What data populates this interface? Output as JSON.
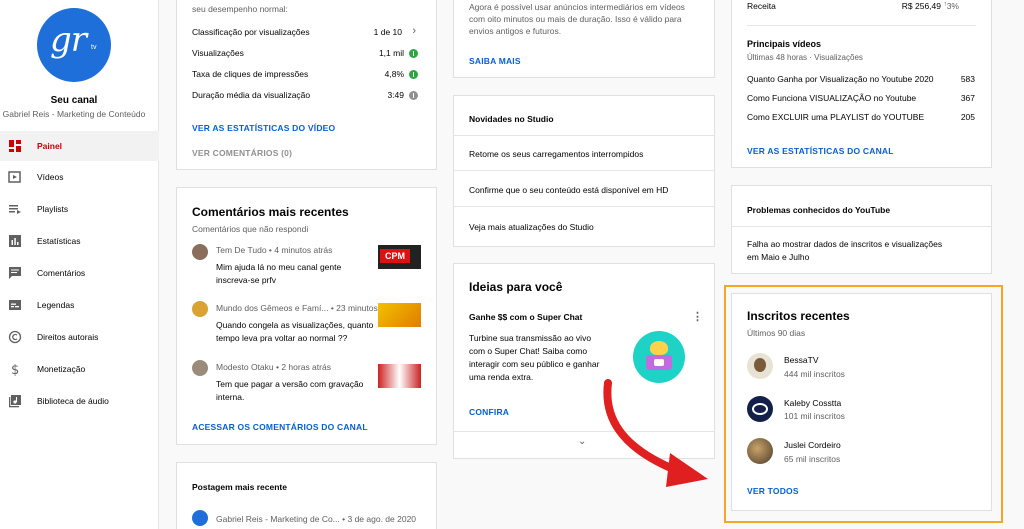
{
  "sidebar": {
    "logo_text": "gr",
    "logo_sub": "tv",
    "channel_title": "Seu canal",
    "channel_name": "Gabriel Reis - Marketing de Conteúdo",
    "items": [
      {
        "label": "Painel",
        "icon": "dashboard-icon",
        "active": true
      },
      {
        "label": "Vídeos",
        "icon": "video-icon"
      },
      {
        "label": "Playlists",
        "icon": "playlist-icon"
      },
      {
        "label": "Estatísticas",
        "icon": "analytics-icon"
      },
      {
        "label": "Comentários",
        "icon": "comments-icon"
      },
      {
        "label": "Legendas",
        "icon": "subtitles-icon"
      },
      {
        "label": "Direitos autorais",
        "icon": "copyright-icon"
      },
      {
        "label": "Monetização",
        "icon": "dollar-icon"
      },
      {
        "label": "Biblioteca de áudio",
        "icon": "audio-library-icon"
      }
    ]
  },
  "video_card": {
    "intro": "seu desempenho normal:",
    "rows": [
      {
        "label": "Classificação por visualizações",
        "value": "1 de 10"
      },
      {
        "label": "Visualizações",
        "value": "1,1 mil"
      },
      {
        "label": "Taxa de cliques de impressões",
        "value": "4,8%"
      },
      {
        "label": "Duração média da visualização",
        "value": "3:49"
      }
    ],
    "stats_link": "VER AS ESTATÍSTICAS DO VÍDEO",
    "comments_link": "VER COMENTÁRIOS (0)"
  },
  "comments_card": {
    "title": "Comentários mais recentes",
    "subtitle": "Comentários que não respondi",
    "comments": [
      {
        "author": "Tem De Tudo",
        "time": "4 minutos atrás",
        "line1": "Mim ajuda lá no meu canal gente",
        "line2": "inscreva-se prfv",
        "thumb_text": "CPM"
      },
      {
        "author": "Mundo dos Gêmeos e Famí...",
        "time": "23 minutos",
        "line1": "Quando congela as visualizações, quanto",
        "line2": "tempo leva pra voltar ao normal ??"
      },
      {
        "author": "Modesto Otaku",
        "time": "2 horas atrás",
        "line1": "Tem que pagar a versão com gravação",
        "line2": "interna."
      }
    ],
    "link": "ACESSAR OS COMENTÁRIOS DO CANAL"
  },
  "post_card": {
    "title": "Postagem mais recente",
    "author": "Gabriel Reis - Marketing de Co...",
    "date": "3 de ago. de 2020"
  },
  "ads_card": {
    "line1": "Agora é possível usar anúncios intermediários em vídeos",
    "line2": "com oito minutos ou mais de duração. Isso é válido para",
    "line3": "envios antigos e futuros.",
    "link": "SAIBA MAIS"
  },
  "studio_card": {
    "title": "Novidades no Studio",
    "items": [
      "Retome os seus carregamentos interrompidos",
      "Confirme que o seu conteúdo está disponível em HD",
      "Veja mais atualizações do Studio"
    ]
  },
  "ideas_card": {
    "title": "Ideias para você",
    "heading": "Ganhe $$ com o Super Chat",
    "lines": [
      "Turbine sua transmissão ao vivo",
      "com o Super Chat! Saiba como",
      "interagir com seu público e ganhar",
      "uma renda extra."
    ],
    "link": "CONFIRA"
  },
  "analytics_card": {
    "revenue_label": "Receita",
    "revenue_value": "R$ 256,49",
    "revenue_change": "3%",
    "top_title": "Principais vídeos",
    "top_subtitle": "Últimas 48 horas · Visualizações",
    "videos": [
      {
        "title": "Quanto Ganha por Visualização no Youtube 2020",
        "views": "583"
      },
      {
        "title": "Como Funciona VISUALIZAÇÃO no Youtube",
        "views": "367"
      },
      {
        "title": "Como EXCLUIR uma PLAYLIST do YOUTUBE",
        "views": "205"
      }
    ],
    "link": "VER AS ESTATÍSTICAS DO CANAL"
  },
  "problems_card": {
    "title": "Problemas conhecidos do YouTube",
    "line1": "Falha ao mostrar dados de inscritos e visualizações",
    "line2": "em Maio e Julho"
  },
  "subscribers_card": {
    "title": "Inscritos recentes",
    "subtitle": "Últimos 90 dias",
    "subscribers": [
      {
        "name": "BessaTV",
        "count": "444 mil inscritos"
      },
      {
        "name": "Kaleby Cosstta",
        "count": "101 mil inscritos"
      },
      {
        "name": "Juslei Cordeiro",
        "count": "65 mil inscritos"
      }
    ],
    "link": "VER TODOS"
  },
  "colors": {
    "accent": "#065fd4",
    "highlight": "#f5a623",
    "arrow": "#e02020",
    "active_nav": "#cc0000"
  }
}
